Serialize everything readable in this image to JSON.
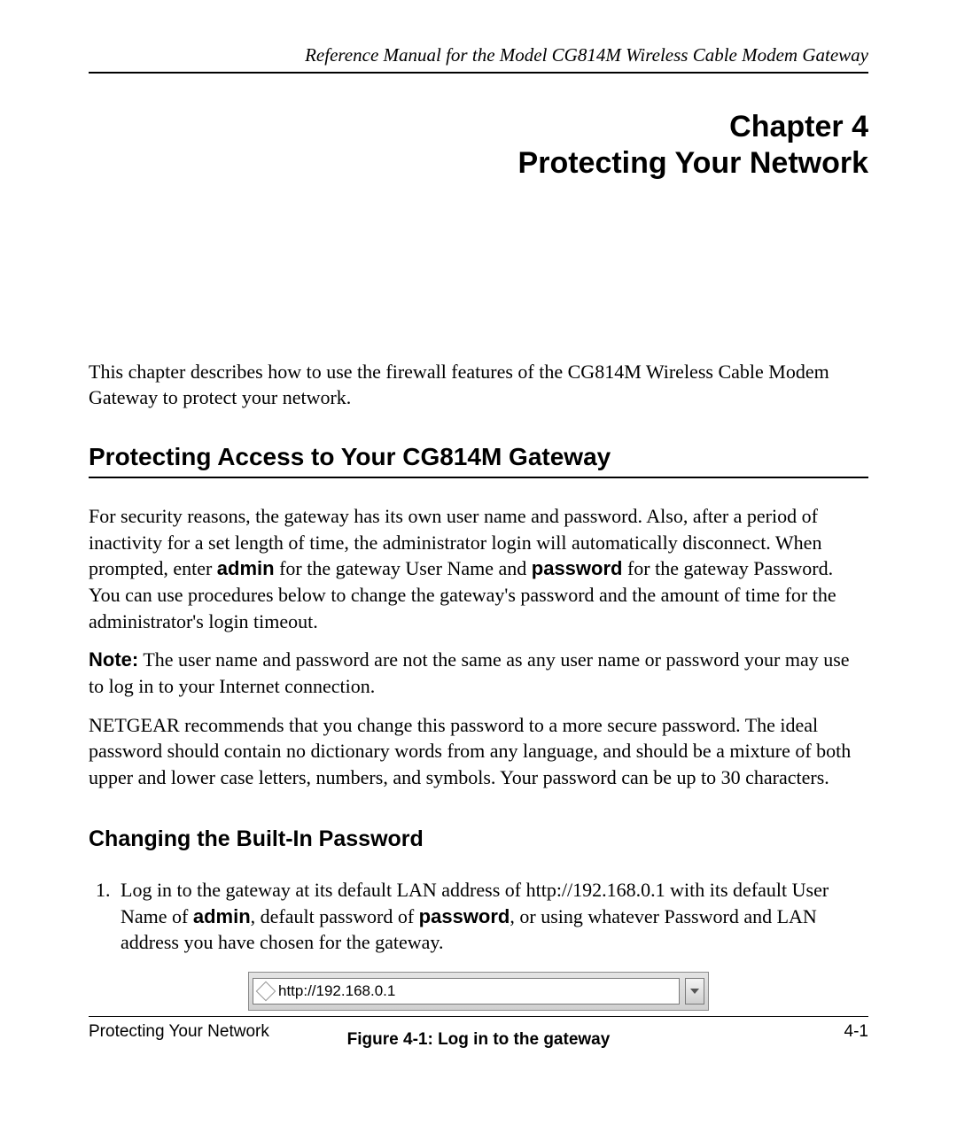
{
  "header": {
    "title": "Reference Manual for the Model CG814M Wireless Cable Modem Gateway"
  },
  "chapter": {
    "number": "Chapter 4",
    "title": "Protecting Your Network"
  },
  "intro": "This chapter describes how to use the firewall features of the CG814M Wireless Cable Modem Gateway to protect your network.",
  "section1": {
    "heading": "Protecting Access to Your CG814M Gateway",
    "p1a": "For security reasons, the gateway has its own user name and password. Also, after a period of inactivity for a set length of time, the administrator login will automatically disconnect. When prompted, enter ",
    "p1b": "admin",
    "p1c": " for the gateway User Name and ",
    "p1d": "password",
    "p1e": " for the gateway Password. You can use procedures below to change the gateway's password and the amount of time for the administrator's login timeout.",
    "note_label": "Note:",
    "note_text": " The user name and password are not the same as any user name or password your may use to log in to your Internet connection.",
    "p3": "NETGEAR recommends that you change this password to a more secure password. The ideal password should contain no dictionary words from any language, and should be a mixture of both upper and lower case letters, numbers, and symbols.  Your password can be up to 30 characters."
  },
  "section2": {
    "heading": "Changing the Built-In Password",
    "step1a": "Log in to the gateway at its default LAN address of http://192.168.0.1 with its default User Name of ",
    "step1b": "admin",
    "step1c": ", default password of ",
    "step1d": "password",
    "step1e": ", or using whatever Password and LAN address you have chosen for the gateway."
  },
  "figure": {
    "url": "http://192.168.0.1",
    "caption": "Figure 4-1: Log in to the gateway"
  },
  "footer": {
    "left": "Protecting Your Network",
    "right": "4-1"
  }
}
